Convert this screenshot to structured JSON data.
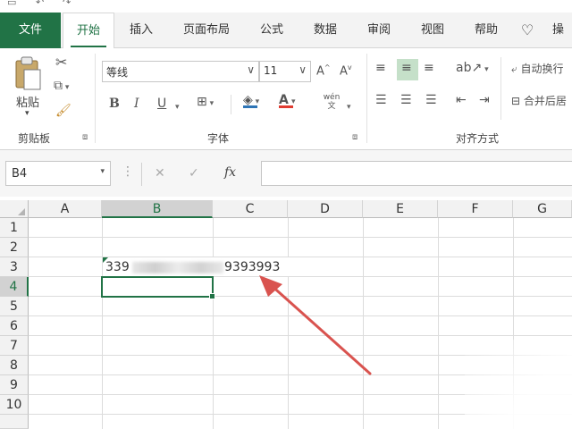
{
  "tabs": [
    "文件",
    "开始",
    "插入",
    "页面布局",
    "公式",
    "数据",
    "审阅",
    "视图",
    "帮助",
    "操"
  ],
  "ribbon": {
    "clipboard": {
      "paste_label": "粘贴",
      "group_label": "剪贴板"
    },
    "font": {
      "name": "等线",
      "size": "11",
      "group_label": "字体",
      "bold": "B",
      "italic": "I",
      "underline": "U",
      "grow": "A",
      "shrink": "A",
      "pinyin": "wén 文"
    },
    "alignment": {
      "wrap_label": "自动换行",
      "merge_label": "合并后居",
      "group_label": "对齐方式"
    }
  },
  "formula_bar": {
    "name_box": "B4",
    "fx": "fx",
    "formula": ""
  },
  "columns": [
    "A",
    "B",
    "C",
    "D",
    "E",
    "F",
    "G"
  ],
  "rows": [
    "1",
    "2",
    "3",
    "4",
    "5",
    "6",
    "7",
    "8",
    "9",
    "10"
  ],
  "cells": {
    "B3": "339",
    "B3_tail": "9393993"
  },
  "colors": {
    "accent": "#217346",
    "arrow": "#d9534f"
  }
}
